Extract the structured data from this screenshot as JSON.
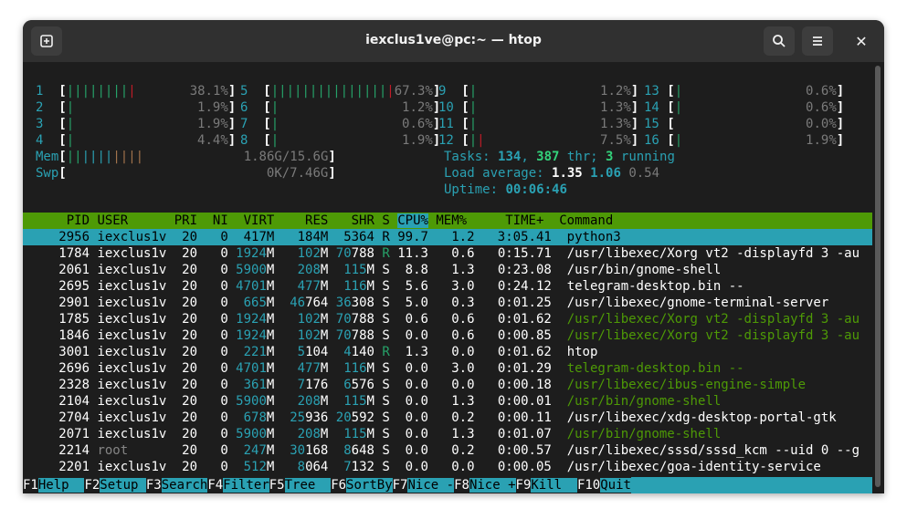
{
  "window": {
    "title": "iexclus1ve@pc:~ — htop"
  },
  "icons": {
    "new_tab": "new-tab-icon",
    "search": "search-icon",
    "menu": "hamburger-menu-icon",
    "close": "close-icon"
  },
  "cpus": [
    {
      "n": "1",
      "pct": "38.1%"
    },
    {
      "n": "2",
      "pct": "1.9%"
    },
    {
      "n": "3",
      "pct": "1.9%"
    },
    {
      "n": "4",
      "pct": "4.4%"
    },
    {
      "n": "5",
      "pct": "67.3%"
    },
    {
      "n": "6",
      "pct": "1.2%"
    },
    {
      "n": "7",
      "pct": "0.6%"
    },
    {
      "n": "8",
      "pct": "1.9%"
    },
    {
      "n": "9",
      "pct": "1.2%"
    },
    {
      "n": "10",
      "pct": "1.3%"
    },
    {
      "n": "11",
      "pct": "1.3%"
    },
    {
      "n": "12",
      "pct": "7.5%"
    },
    {
      "n": "13",
      "pct": "0.6%"
    },
    {
      "n": "14",
      "pct": "0.6%"
    },
    {
      "n": "15",
      "pct": "0.0%"
    },
    {
      "n": "16",
      "pct": "1.9%"
    }
  ],
  "memory": {
    "label": "Mem",
    "value": "1.86G/15.6G"
  },
  "swap": {
    "label": "Swp",
    "value": "0K/7.46G"
  },
  "tasks": {
    "label": "Tasks: ",
    "tasks": "134",
    "threads": "387",
    "thr_label": " thr; ",
    "running": "3",
    "running_label": " running"
  },
  "load": {
    "label": "Load average: ",
    "l1": "1.35",
    "l5": "1.06",
    "l15": "0.54"
  },
  "uptime": {
    "label": "Uptime: ",
    "value": "00:06:46"
  },
  "columns": [
    "PID",
    "USER",
    "PRI",
    "NI",
    "VIRT",
    "RES",
    "SHR",
    "S",
    "CPU%",
    "MEM%",
    "TIME+",
    "Command"
  ],
  "processes": [
    {
      "pid": "2956",
      "user": "iexclus1v",
      "pri": "20",
      "ni": "0",
      "virt": "417M",
      "res": "184M",
      "shr": "5364",
      "s": "R",
      "cpu": "99.7",
      "mem": "1.2",
      "time": "3:05.41",
      "cmd": "python3"
    },
    {
      "pid": "1784",
      "user": "iexclus1v",
      "pri": "20",
      "ni": "0",
      "virt": "1924M",
      "res": "102M",
      "shr": "70788",
      "s": "R",
      "cpu": "11.3",
      "mem": "0.6",
      "time": "0:15.71",
      "cmd": "/usr/libexec/Xorg vt2 -displayfd 3 -au"
    },
    {
      "pid": "2061",
      "user": "iexclus1v",
      "pri": "20",
      "ni": "0",
      "virt": "5900M",
      "res": "208M",
      "shr": "115M",
      "s": "S",
      "cpu": "8.8",
      "mem": "1.3",
      "time": "0:23.08",
      "cmd": "/usr/bin/gnome-shell"
    },
    {
      "pid": "2695",
      "user": "iexclus1v",
      "pri": "20",
      "ni": "0",
      "virt": "4701M",
      "res": "477M",
      "shr": "116M",
      "s": "S",
      "cpu": "5.6",
      "mem": "3.0",
      "time": "0:24.12",
      "cmd": "telegram-desktop.bin --"
    },
    {
      "pid": "2901",
      "user": "iexclus1v",
      "pri": "20",
      "ni": "0",
      "virt": "665M",
      "res": "46764",
      "shr": "36308",
      "s": "S",
      "cpu": "5.0",
      "mem": "0.3",
      "time": "0:01.25",
      "cmd": "/usr/libexec/gnome-terminal-server"
    },
    {
      "pid": "1785",
      "user": "iexclus1v",
      "pri": "20",
      "ni": "0",
      "virt": "1924M",
      "res": "102M",
      "shr": "70788",
      "s": "S",
      "cpu": "0.6",
      "mem": "0.6",
      "time": "0:01.62",
      "cmd": "/usr/libexec/Xorg vt2 -displayfd 3 -au"
    },
    {
      "pid": "1846",
      "user": "iexclus1v",
      "pri": "20",
      "ni": "0",
      "virt": "1924M",
      "res": "102M",
      "shr": "70788",
      "s": "S",
      "cpu": "0.0",
      "mem": "0.6",
      "time": "0:00.85",
      "cmd": "/usr/libexec/Xorg vt2 -displayfd 3 -au"
    },
    {
      "pid": "3001",
      "user": "iexclus1v",
      "pri": "20",
      "ni": "0",
      "virt": "221M",
      "res": "5104",
      "shr": "4140",
      "s": "R",
      "cpu": "1.3",
      "mem": "0.0",
      "time": "0:01.62",
      "cmd": "htop"
    },
    {
      "pid": "2696",
      "user": "iexclus1v",
      "pri": "20",
      "ni": "0",
      "virt": "4701M",
      "res": "477M",
      "shr": "116M",
      "s": "S",
      "cpu": "0.0",
      "mem": "3.0",
      "time": "0:01.29",
      "cmd": "telegram-desktop.bin --"
    },
    {
      "pid": "2328",
      "user": "iexclus1v",
      "pri": "20",
      "ni": "0",
      "virt": "361M",
      "res": "7176",
      "shr": "6576",
      "s": "S",
      "cpu": "0.0",
      "mem": "0.0",
      "time": "0:00.18",
      "cmd": "/usr/libexec/ibus-engine-simple"
    },
    {
      "pid": "2104",
      "user": "iexclus1v",
      "pri": "20",
      "ni": "0",
      "virt": "5900M",
      "res": "208M",
      "shr": "115M",
      "s": "S",
      "cpu": "0.0",
      "mem": "1.3",
      "time": "0:00.01",
      "cmd": "/usr/bin/gnome-shell"
    },
    {
      "pid": "2704",
      "user": "iexclus1v",
      "pri": "20",
      "ni": "0",
      "virt": "678M",
      "res": "25936",
      "shr": "20592",
      "s": "S",
      "cpu": "0.0",
      "mem": "0.2",
      "time": "0:00.11",
      "cmd": "/usr/libexec/xdg-desktop-portal-gtk"
    },
    {
      "pid": "2071",
      "user": "iexclus1v",
      "pri": "20",
      "ni": "0",
      "virt": "5900M",
      "res": "208M",
      "shr": "115M",
      "s": "S",
      "cpu": "0.0",
      "mem": "1.3",
      "time": "0:01.07",
      "cmd": "/usr/bin/gnome-shell"
    },
    {
      "pid": "2214",
      "user": "root",
      "pri": "20",
      "ni": "0",
      "virt": "247M",
      "res": "30168",
      "shr": "8648",
      "s": "S",
      "cpu": "0.0",
      "mem": "0.2",
      "time": "0:00.57",
      "cmd": "/usr/libexec/sssd/sssd_kcm --uid 0 --g"
    },
    {
      "pid": "2201",
      "user": "iexclus1v",
      "pri": "20",
      "ni": "0",
      "virt": "512M",
      "res": "8064",
      "shr": "7132",
      "s": "S",
      "cpu": "0.0",
      "mem": "0.0",
      "time": "0:00.05",
      "cmd": "/usr/libexec/goa-identity-service"
    }
  ],
  "function_keys": [
    {
      "key": "F1",
      "label": "Help  "
    },
    {
      "key": "F2",
      "label": "Setup "
    },
    {
      "key": "F3",
      "label": "Search"
    },
    {
      "key": "F4",
      "label": "Filter"
    },
    {
      "key": "F5",
      "label": "Tree  "
    },
    {
      "key": "F6",
      "label": "SortBy"
    },
    {
      "key": "F7",
      "label": "Nice -"
    },
    {
      "key": "F8",
      "label": "Nice +"
    },
    {
      "key": "F9",
      "label": "Kill  "
    },
    {
      "key": "F10",
      "label": "Quit"
    }
  ]
}
